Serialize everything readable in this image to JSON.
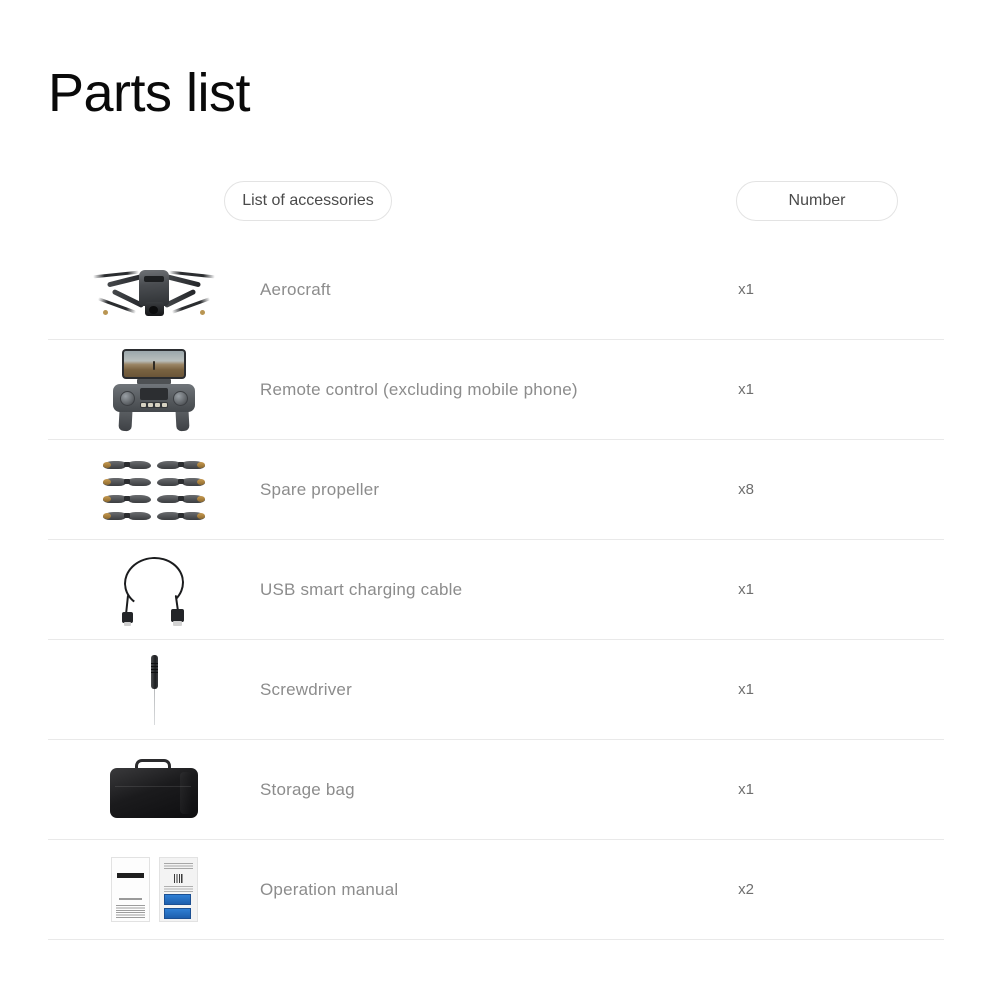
{
  "page": {
    "title": "Parts list",
    "background_color": "#ffffff",
    "divider_color": "#e9e9e9",
    "label_text_color": "#8c8c8c",
    "qty_text_color": "#6f6f6f"
  },
  "header": {
    "accessories_label": "List of accessories",
    "number_label": "Number"
  },
  "parts": [
    {
      "icon": "drone-icon",
      "name": "Aerocraft",
      "qty": "x1"
    },
    {
      "icon": "remote-control-icon",
      "name": "Remote control (excluding mobile phone)",
      "qty": "x1"
    },
    {
      "icon": "propeller-icon",
      "name": "Spare propeller",
      "qty": "x8"
    },
    {
      "icon": "usb-cable-icon",
      "name": "USB smart charging cable",
      "qty": "x1"
    },
    {
      "icon": "screwdriver-icon",
      "name": "Screwdriver",
      "qty": "x1"
    },
    {
      "icon": "storage-bag-icon",
      "name": "Storage bag",
      "qty": "x1"
    },
    {
      "icon": "manual-icon",
      "name": "Operation manual",
      "qty": "x2"
    }
  ]
}
